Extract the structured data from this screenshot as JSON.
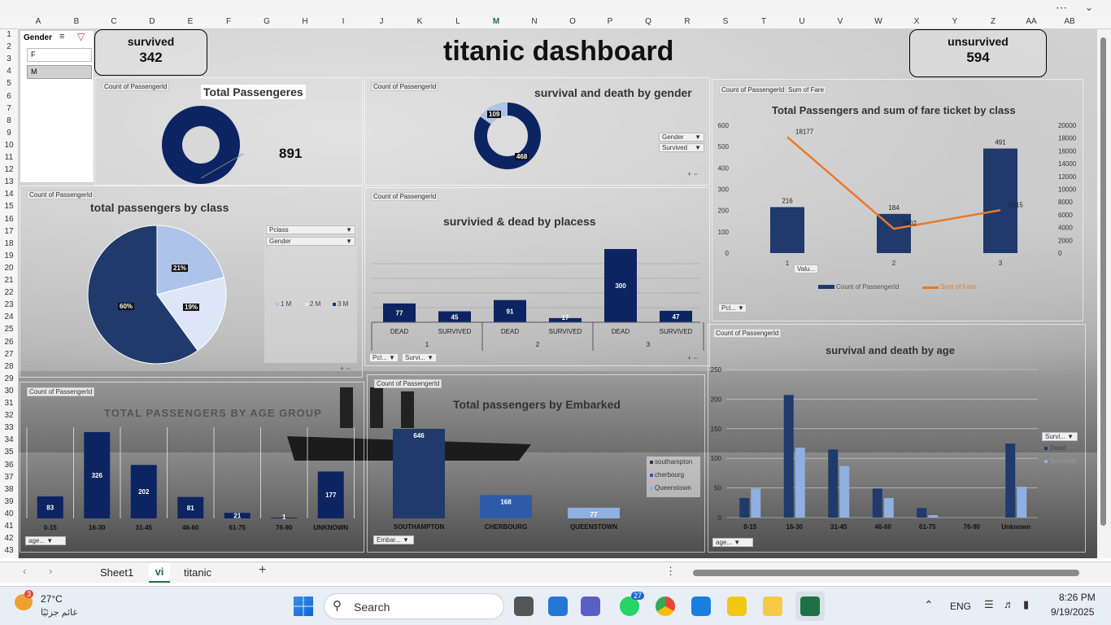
{
  "columns": [
    "A",
    "B",
    "C",
    "D",
    "E",
    "F",
    "G",
    "H",
    "I",
    "J",
    "K",
    "L",
    "M",
    "N",
    "O",
    "P",
    "Q",
    "R",
    "S",
    "T",
    "U",
    "V",
    "W",
    "X",
    "Y",
    "Z",
    "AA",
    "AB"
  ],
  "rows": [
    "1",
    "2",
    "3",
    "4",
    "5",
    "6",
    "7",
    "8",
    "9",
    "10",
    "11",
    "12",
    "13",
    "14",
    "15",
    "16",
    "17",
    "18",
    "19",
    "20",
    "21",
    "22",
    "23",
    "24",
    "25",
    "26",
    "27",
    "28",
    "29",
    "30",
    "31",
    "32",
    "33",
    "34",
    "35",
    "36",
    "37",
    "38",
    "39",
    "40",
    "41",
    "42",
    "43"
  ],
  "dashboard_title": "titanic dashboard",
  "kpi": {
    "survived_label": "survived",
    "survived_value": "342",
    "unsurvived_label": "unsurvived",
    "unsurvived_value": "594"
  },
  "slicer": {
    "title": "Gender",
    "items": [
      "F",
      "M"
    ]
  },
  "field_tag": "Count of PassengerId",
  "field_tag_sum": "Sum of Fare",
  "total": {
    "title": "Total Passengeres",
    "value": "891"
  },
  "gender": {
    "title": "survival and death by gender",
    "labels": [
      "109",
      "468"
    ],
    "filters": [
      "Gender",
      "Survived"
    ]
  },
  "fare": {
    "title": "Total Passengers and sum of fare ticket by class",
    "bars": [
      216,
      184,
      491
    ],
    "fare": [
      18177,
      3802,
      6715
    ],
    "fare_labels": [
      "18177",
      "3802",
      "6715"
    ],
    "xlabels": [
      "1",
      "2",
      "3"
    ],
    "left_axis": [
      "600",
      "500",
      "400",
      "300",
      "200",
      "100",
      "0"
    ],
    "right_axis": [
      "20000",
      "18000",
      "16000",
      "14000",
      "12000",
      "10000",
      "8000",
      "6000",
      "4000",
      "2000",
      "0"
    ],
    "legend": [
      "Count of PassengerId",
      "Sum of Fare"
    ],
    "filter": "Pcl...",
    "val_btn": "Valu..."
  },
  "class_pie": {
    "title": "total passengers by class",
    "labels": [
      "21%",
      "19%",
      "60%"
    ],
    "legend": [
      "1 M",
      "2 M",
      "3 M"
    ],
    "filters": [
      "Pclass",
      "Gender"
    ]
  },
  "places": {
    "title": "survivied & dead by placess",
    "values": [
      77,
      45,
      91,
      17,
      300,
      47
    ],
    "labels": [
      "DEAD",
      "SURVIVED",
      "DEAD",
      "SURVIVED",
      "DEAD",
      "SURVIVED"
    ],
    "groups": [
      "1",
      "2",
      "3"
    ],
    "filters": [
      "Pcl...",
      "Survi..."
    ]
  },
  "age_group": {
    "title": "TOTAL PASSENGERS BY AGE GROUP",
    "values": [
      83,
      326,
      202,
      81,
      21,
      1,
      177
    ],
    "categories": [
      "0-15",
      "16-30",
      "31-45",
      "46-60",
      "61-75",
      "76-90",
      "UNKNOWN"
    ],
    "filter": "age..."
  },
  "embarked": {
    "title": "Total passengers by Embarked",
    "values": [
      646,
      168,
      77
    ],
    "categories": [
      "SOUTHAMPTON",
      "CHERBOURG",
      "QUEENSTOWN"
    ],
    "legend": [
      "southampton",
      "cherbourg",
      "Queenstown"
    ],
    "filter": "Embar..."
  },
  "age_surv": {
    "title": "survival and death by age",
    "dead": [
      33,
      207,
      115,
      49,
      16,
      0,
      125
    ],
    "survived": [
      49,
      118,
      87,
      33,
      4,
      0,
      52
    ],
    "categories": [
      "0-15",
      "16-30",
      "31-45",
      "46-60",
      "61-75",
      "76-90",
      "Unknown"
    ],
    "axis": [
      "250",
      "200",
      "150",
      "100",
      "50",
      "0"
    ],
    "legend_title": "Survi...",
    "legend": [
      "Dead",
      "Survived"
    ],
    "filter": "age..."
  },
  "tabs": [
    "Sheet1",
    "vi",
    "titanic"
  ],
  "taskbar": {
    "weather": "27°C",
    "weather_sub": "غائم جزئيًا",
    "weather_badge": "3",
    "search": "Search",
    "lang": "ENG",
    "time": "8:26 PM",
    "date": "9/19/2025",
    "whatsapp_badge": "27"
  },
  "colors": {
    "navy": "#1f3a6b",
    "dark_navy": "#0d2463",
    "mid_blue": "#2f5aa8",
    "light_blue": "#aec3e8",
    "orange": "#e8792a"
  }
}
